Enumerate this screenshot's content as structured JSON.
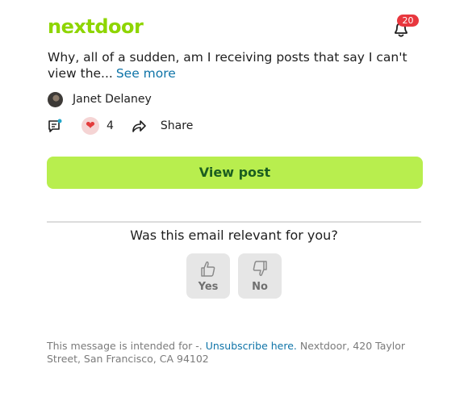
{
  "header": {
    "logo_text": "nextdoor",
    "notification_count": "20"
  },
  "post": {
    "text": "Why, all of a sudden, am I receiving posts that say I can't view the...",
    "see_more_label": "See more",
    "author_name": "Janet Delaney",
    "reaction_count": "4",
    "share_label": "Share"
  },
  "cta": {
    "label": "View post"
  },
  "feedback": {
    "question": "Was this email relevant for you?",
    "yes_label": "Yes",
    "no_label": "No"
  },
  "footer": {
    "prefix": "This message is intended for -.",
    "unsubscribe_label": "Unsubscribe here.",
    "address": "Nextdoor, 420 Taylor Street, San Francisco, CA 94102"
  },
  "colors": {
    "brand_green": "#8ed500",
    "cta_background": "#b8ee4e",
    "cta_text": "#1b5e20",
    "link_blue": "#0f74a8",
    "badge_red": "#e8373e"
  }
}
